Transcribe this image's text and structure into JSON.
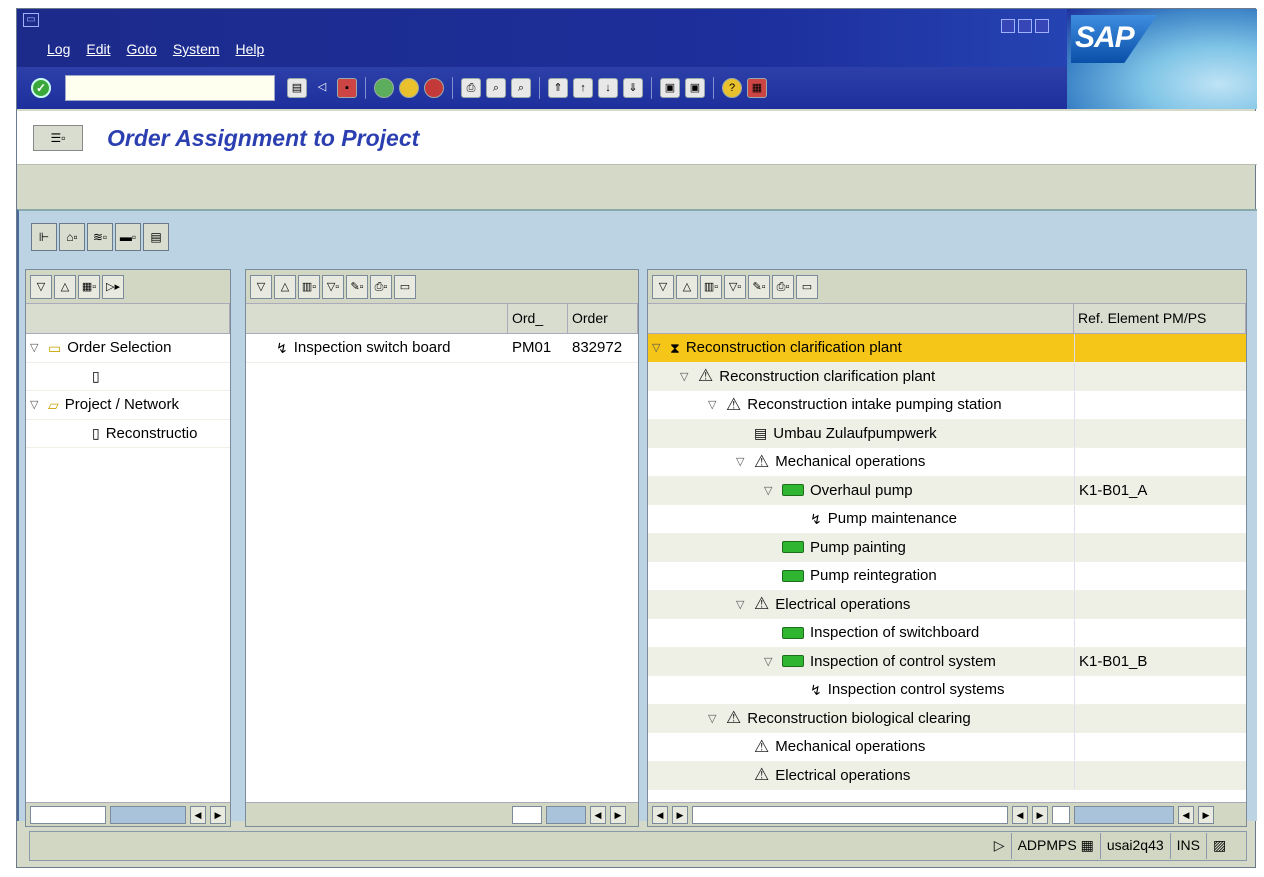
{
  "menu": [
    "Log",
    "Edit",
    "Goto",
    "System",
    "Help"
  ],
  "brand": "SAP",
  "page_title": "Order Assignment to Project",
  "left_pane": {
    "items": [
      {
        "label": "Order Selection",
        "indent": 0,
        "icon": "folder-icon",
        "expand": true
      },
      {
        "label": "",
        "indent": 1,
        "icon": "document-icon",
        "expand": false
      },
      {
        "label": "Project / Network",
        "indent": 0,
        "icon": "folder-open-icon",
        "expand": true
      },
      {
        "label": "Reconstructio",
        "indent": 1,
        "icon": "document-icon",
        "expand": false
      }
    ]
  },
  "middle_pane": {
    "columns": [
      "Ord_",
      "Order"
    ],
    "rows": [
      {
        "label": "Inspection switch board",
        "ord": "PM01",
        "order": "832972"
      }
    ]
  },
  "right_pane": {
    "column": "Ref. Element PM/PS",
    "rows": [
      {
        "label": "Reconstruction clarification plant",
        "indent": 0,
        "icon": "project-icon",
        "expand": true,
        "ref": "",
        "selected": true
      },
      {
        "label": "Reconstruction clarification plant",
        "indent": 1,
        "icon": "warning-triangle-icon",
        "expand": true,
        "ref": ""
      },
      {
        "label": "Reconstruction intake pumping station",
        "indent": 2,
        "icon": "warning-triangle-icon",
        "expand": true,
        "ref": ""
      },
      {
        "label": "Umbau Zulaufpumpwerk",
        "indent": 3,
        "icon": "network-icon",
        "expand": false,
        "ref": ""
      },
      {
        "label": "Mechanical operations",
        "indent": 3,
        "icon": "warning-triangle-icon",
        "expand": true,
        "ref": ""
      },
      {
        "label": "Overhaul pump",
        "indent": 4,
        "icon": "activity-bar-icon",
        "expand": true,
        "ref": "K1-B01_A"
      },
      {
        "label": "Pump maintenance",
        "indent": 5,
        "icon": "order-icon",
        "expand": false,
        "ref": ""
      },
      {
        "label": "Pump painting",
        "indent": 4,
        "icon": "activity-bar-icon",
        "expand": false,
        "ref": ""
      },
      {
        "label": "Pump reintegration",
        "indent": 4,
        "icon": "activity-bar-icon",
        "expand": false,
        "ref": ""
      },
      {
        "label": "Electrical operations",
        "indent": 3,
        "icon": "warning-triangle-icon",
        "expand": true,
        "ref": ""
      },
      {
        "label": "Inspection of switchboard",
        "indent": 4,
        "icon": "activity-bar-icon",
        "expand": false,
        "ref": ""
      },
      {
        "label": "Inspection of control system",
        "indent": 4,
        "icon": "activity-bar-icon",
        "expand": true,
        "ref": "K1-B01_B"
      },
      {
        "label": "Inspection control systems",
        "indent": 5,
        "icon": "order-icon",
        "expand": false,
        "ref": ""
      },
      {
        "label": "Reconstruction biological clearing",
        "indent": 2,
        "icon": "warning-triangle-icon",
        "expand": true,
        "ref": ""
      },
      {
        "label": "Mechanical operations",
        "indent": 3,
        "icon": "warning-triangle-icon",
        "expand": false,
        "ref": ""
      },
      {
        "label": "Electrical operations",
        "indent": 3,
        "icon": "warning-triangle-icon",
        "expand": false,
        "ref": ""
      }
    ]
  },
  "status": {
    "system": "ADPMPS",
    "server": "usai2q43",
    "mode": "INS"
  }
}
